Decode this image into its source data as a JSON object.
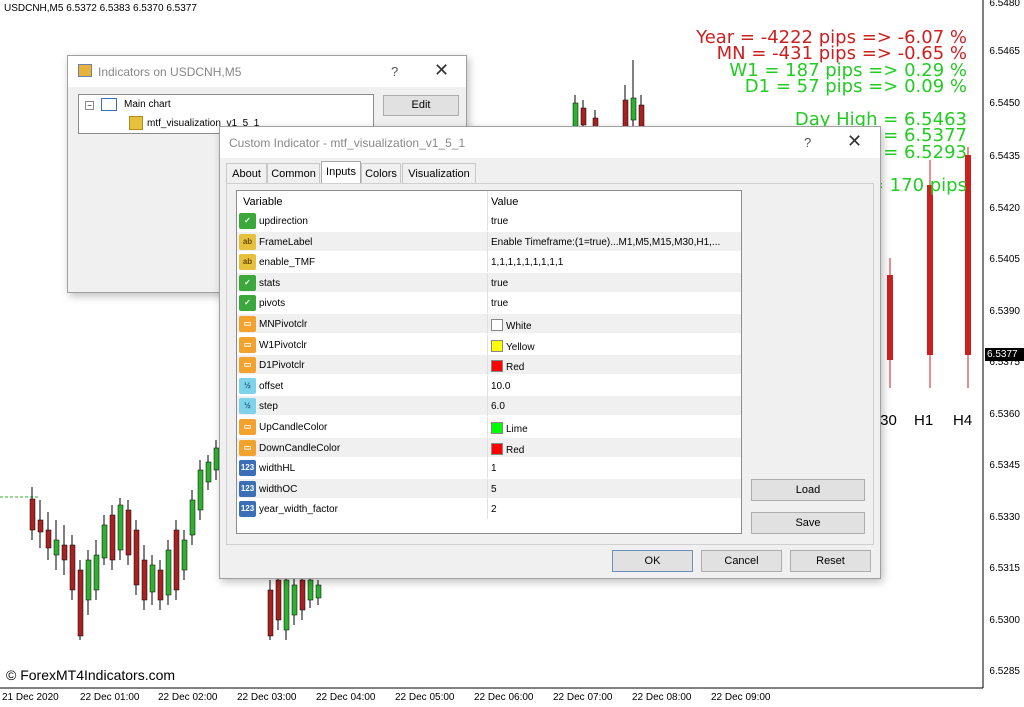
{
  "chart": {
    "symbol_header": "USDCNH,M5  6.5372 6.5383 6.5370 6.5377",
    "watermark": "© ForexMT4Indicators.com",
    "price_labels": [
      "6.5480",
      "6.5465",
      "6.5450",
      "6.5435",
      "6.5420",
      "6.5405",
      "6.5390",
      "6.5375",
      "6.5360",
      "6.5345",
      "6.5330",
      "6.5315",
      "6.5300",
      "6.5285"
    ],
    "current_price": "6.5377",
    "time_labels": [
      "21 Dec 2020",
      "22 Dec 01:00",
      "22 Dec 02:00",
      "22 Dec 03:00",
      "22 Dec 04:00",
      "22 Dec 05:00",
      "22 Dec 06:00",
      "22 Dec 07:00",
      "22 Dec 08:00",
      "22 Dec 09:00"
    ],
    "stats": {
      "year": "Year = -4222 pips => -6.07 %",
      "mn": "MN = -431 pips => -0.65 %",
      "w1": "W1 = 187 pips => 0.29 %",
      "d1": "D1 = 57 pips => 0.09 %",
      "day_high": "Day High = 6.5463",
      "day_price_frag": "e = 6.5377",
      "day_low_frag": "w = 6.5293",
      "range_frag": "= 170  pips"
    },
    "tf_labels": [
      "I30",
      "H1",
      "H4"
    ],
    "colors": {
      "red": "#cc2020",
      "green": "#22cc22",
      "bull": "#2fb12f",
      "bear": "#a82222"
    }
  },
  "indicators_window": {
    "title": "Indicators on USDCNH,M5",
    "help": "?",
    "close": "✕",
    "tree": {
      "root": "Main chart",
      "child": "mtf_visualization_v1_5_1"
    },
    "edit_button": "Edit"
  },
  "custom_window": {
    "title": "Custom Indicator - mtf_visualization_v1_5_1",
    "help": "?",
    "close": "✕",
    "tabs": [
      "About",
      "Common",
      "Inputs",
      "Colors",
      "Visualization"
    ],
    "active_tab": "Inputs",
    "columns": [
      "Variable",
      "Value"
    ],
    "rows": [
      {
        "name": "updirection",
        "value": "true",
        "type": "bool"
      },
      {
        "name": "FrameLabel",
        "value": "Enable Timeframe:(1=true)...M1,M5,M15,M30,H1,...",
        "type": "str"
      },
      {
        "name": "enable_TMF",
        "value": "1,1,1,1,1,1,1,1,1",
        "type": "str"
      },
      {
        "name": "stats",
        "value": "true",
        "type": "bool"
      },
      {
        "name": "pivots",
        "value": "true",
        "type": "bool"
      },
      {
        "name": "MNPivotclr",
        "value": "White",
        "type": "color",
        "swatch": "#ffffff"
      },
      {
        "name": "W1Pivotclr",
        "value": "Yellow",
        "type": "color",
        "swatch": "#ffff00"
      },
      {
        "name": "D1Pivotclr",
        "value": "Red",
        "type": "color",
        "swatch": "#ff0000"
      },
      {
        "name": "offset",
        "value": "10.0",
        "type": "dbl"
      },
      {
        "name": "step",
        "value": "6.0",
        "type": "dbl"
      },
      {
        "name": "UpCandleColor",
        "value": "Lime",
        "type": "color",
        "swatch": "#00ff00"
      },
      {
        "name": "DownCandleColor",
        "value": "Red",
        "type": "color",
        "swatch": "#ff0000"
      },
      {
        "name": "widthHL",
        "value": "1",
        "type": "int"
      },
      {
        "name": "widthOC",
        "value": "5",
        "type": "int"
      },
      {
        "name": "year_width_factor",
        "value": "2",
        "type": "int"
      }
    ],
    "buttons": {
      "load": "Load",
      "save": "Save",
      "ok": "OK",
      "cancel": "Cancel",
      "reset": "Reset"
    },
    "icon_glyphs": {
      "bool": "✓",
      "str": "ab",
      "color": "▭",
      "dbl": "½",
      "int": "123"
    }
  }
}
